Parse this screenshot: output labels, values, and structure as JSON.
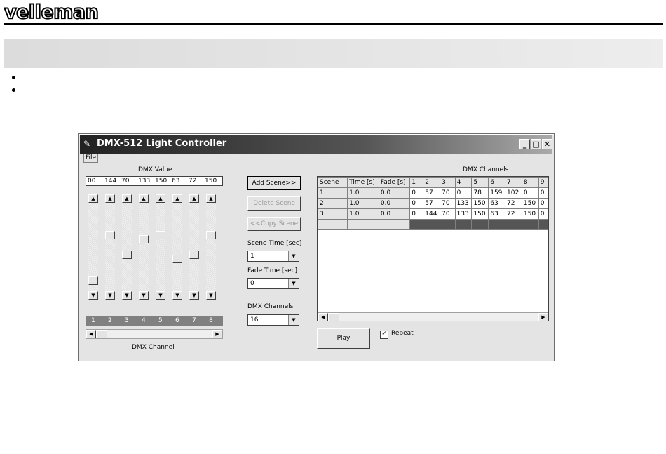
{
  "header": {
    "logo": "velleman"
  },
  "window": {
    "title": "DMX-512 Light Controller",
    "menu": {
      "file": "File"
    },
    "dmx_value_label": "DMX Value",
    "values": [
      "00",
      "144",
      "70",
      "133",
      "150",
      "63",
      "72",
      "150"
    ],
    "sliders": [
      0.08,
      0.65,
      0.4,
      0.6,
      0.65,
      0.35,
      0.4,
      0.65
    ],
    "channel_numbers": [
      "1",
      "2",
      "3",
      "4",
      "5",
      "6",
      "7",
      "8"
    ],
    "dmx_channel_label": "DMX Channel",
    "buttons": {
      "add_scene": "Add Scene>>",
      "delete_scene": "Delete Scene",
      "copy_scene": "<<Copy Scene",
      "play": "Play"
    },
    "scene_time_label": "Scene Time [sec]",
    "scene_time_value": "1",
    "fade_time_label": "Fade Time [sec]",
    "fade_time_value": "0",
    "dmx_channels_label": "DMX Channels",
    "dmx_channels_value": "16",
    "grid_title": "DMX Channels",
    "grid": {
      "headers": [
        "Scene",
        "Time [s]",
        "Fade [s]",
        "1",
        "2",
        "3",
        "4",
        "5",
        "6",
        "7",
        "8",
        "9"
      ],
      "rows": [
        [
          "1",
          "1.0",
          "0.0",
          "0",
          "57",
          "70",
          "0",
          "78",
          "159",
          "102",
          "0",
          "0"
        ],
        [
          "2",
          "1.0",
          "0.0",
          "0",
          "57",
          "70",
          "133",
          "150",
          "63",
          "72",
          "150",
          "0"
        ],
        [
          "3",
          "1.0",
          "0.0",
          "0",
          "144",
          "70",
          "133",
          "150",
          "63",
          "72",
          "150",
          "0"
        ]
      ]
    },
    "repeat_label": "Repeat",
    "repeat_checked": true
  }
}
